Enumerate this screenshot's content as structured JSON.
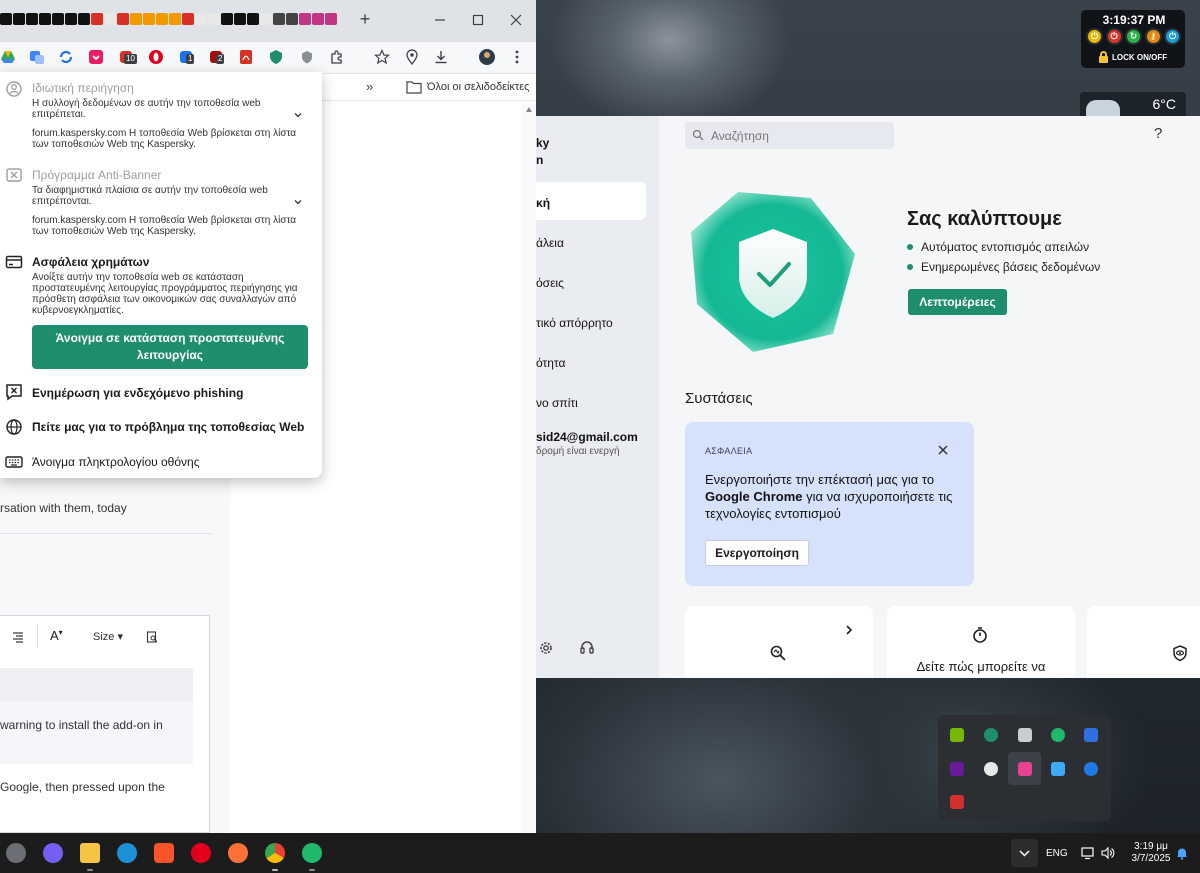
{
  "desktop": {
    "clock": {
      "time": "3:19:37 PM",
      "lock_label": "LOCK ON/OFF"
    },
    "weather": {
      "temp": "6°C"
    }
  },
  "chrome": {
    "new_tab": "+",
    "bookmarks": {
      "more": "»",
      "all_bookmarks": "Όλοι οι σελιδοδείκτες"
    },
    "extension_badges": [
      "10",
      "1",
      "2"
    ],
    "kaspersky_menu": {
      "private_browsing": {
        "title": "Ιδιωτική περιήγηση",
        "desc": "Η συλλογή δεδομένων σε αυτήν την τοποθεσία web επιτρέπεται.",
        "note": "forum.kaspersky.com Η τοποθεσία Web βρίσκεται στη λίστα των τοποθεσιών Web της Kaspersky."
      },
      "anti_banner": {
        "title": "Πρόγραμμα Anti-Banner",
        "desc": "Τα διαφημιστικά πλαίσια σε αυτήν την τοποθεσία web επιτρέπονται.",
        "note": "forum.kaspersky.com Η τοποθεσία Web βρίσκεται στη λίστα των τοποθεσιών Web της Kaspersky."
      },
      "safe_money": {
        "title": "Ασφάλεια χρημάτων",
        "desc": "Ανοίξτε αυτήν την τοποθεσία web σε κατάσταση προστατευμένης λειτουργίας προγράμματος περιήγησης για πρόσθετη ασφάλεια των οικονομικών σας συναλλαγών από κυβερνοεγκληματίες.",
        "button_line1": "Άνοιγμα σε κατάσταση προστατευμένης",
        "button_line2": "λειτουργίας"
      },
      "phishing": "Ενημέρωση για ενδεχόμενο phishing",
      "report_site": "Πείτε μας για το πρόβλημα της τοποθεσίας Web",
      "keyboard": "Άνοιγμα πληκτρολογίου οθόνης"
    },
    "page": {
      "post_line": "rsation with them, today",
      "editor": {
        "size_label": "Size",
        "color_label": "A"
      },
      "quote_text": "warning to install the add-on in",
      "body_text": "Google, then pressed upon the"
    }
  },
  "kaspersky": {
    "sidebar": {
      "brand_line1": "ky",
      "brand_line2": "n",
      "items": [
        "κή",
        "άλεια",
        "όσεις",
        "τικό απόρρητο",
        "ότητα",
        "νο σπίτι"
      ],
      "account_email": "sid24@gmail.com",
      "account_status": "δρομή είναι ενεργή"
    },
    "search_placeholder": "Αναζήτηση",
    "help": "?",
    "hero": {
      "title": "Σας καλύπτουμε",
      "bullets": [
        "Αυτόματος εντοπισμός απειλών",
        "Ενημερωμένες βάσεις δεδομένων"
      ],
      "details_button": "Λεπτομέρειες"
    },
    "recommendations": {
      "title": "Συστάσεις",
      "card": {
        "badge": "ΑΣΦΑΛΕΙΑ",
        "text_pre": "Ενεργοποιήστε την επέκτασή μας για το",
        "text_bold": "Google Chrome",
        "text_post": "για να ισχυροποιήσετε τις τεχνολογίες εντοπισμού",
        "button": "Ενεργοποίηση"
      }
    },
    "tile2_text": "Δείτε πώς μπορείτε να"
  },
  "taskbar": {
    "lang": "ENG",
    "time": "3:19 μμ",
    "date": "3/7/2025"
  },
  "colors": {
    "kaspersky_green": "#1e8e6e",
    "reco_card": "#d6e2fb"
  }
}
